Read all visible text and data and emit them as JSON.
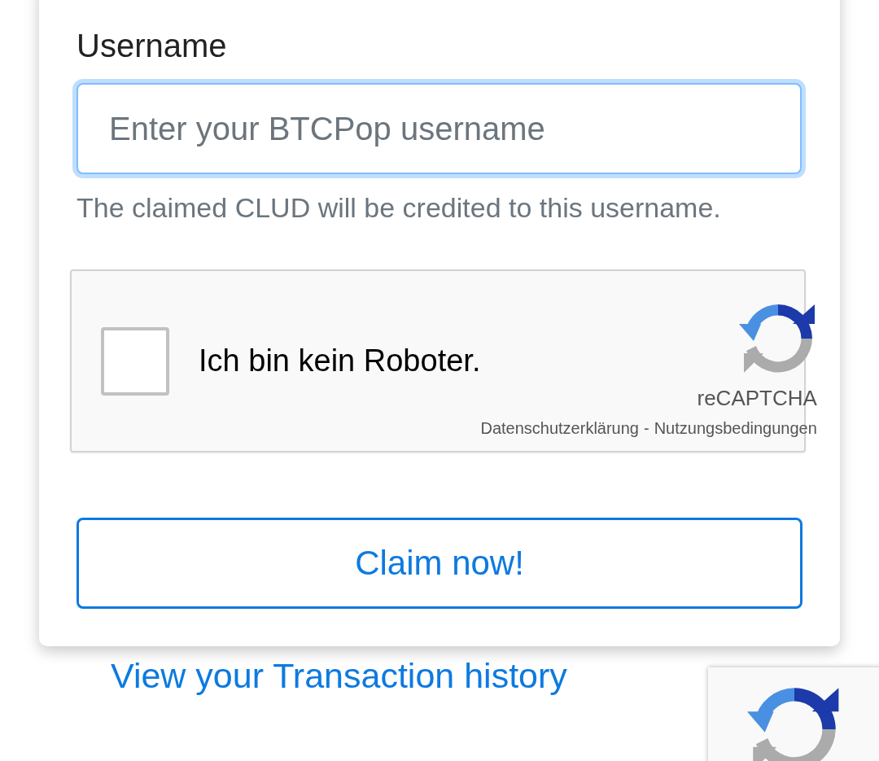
{
  "form": {
    "label": "Username",
    "input": {
      "placeholder": "Enter your BTCPop username",
      "focused": true
    },
    "help": "The claimed CLUD will be credited to this username."
  },
  "captcha": {
    "checked": false,
    "label": "Ich bin kein Roboter.",
    "brand": "reCAPTCHA",
    "privacy_link": "Datenschutzerklärung",
    "separator": "-",
    "terms_link": "Nutzungsbedingungen"
  },
  "button": "Claim now!",
  "history_link": "View your Transaction history"
}
